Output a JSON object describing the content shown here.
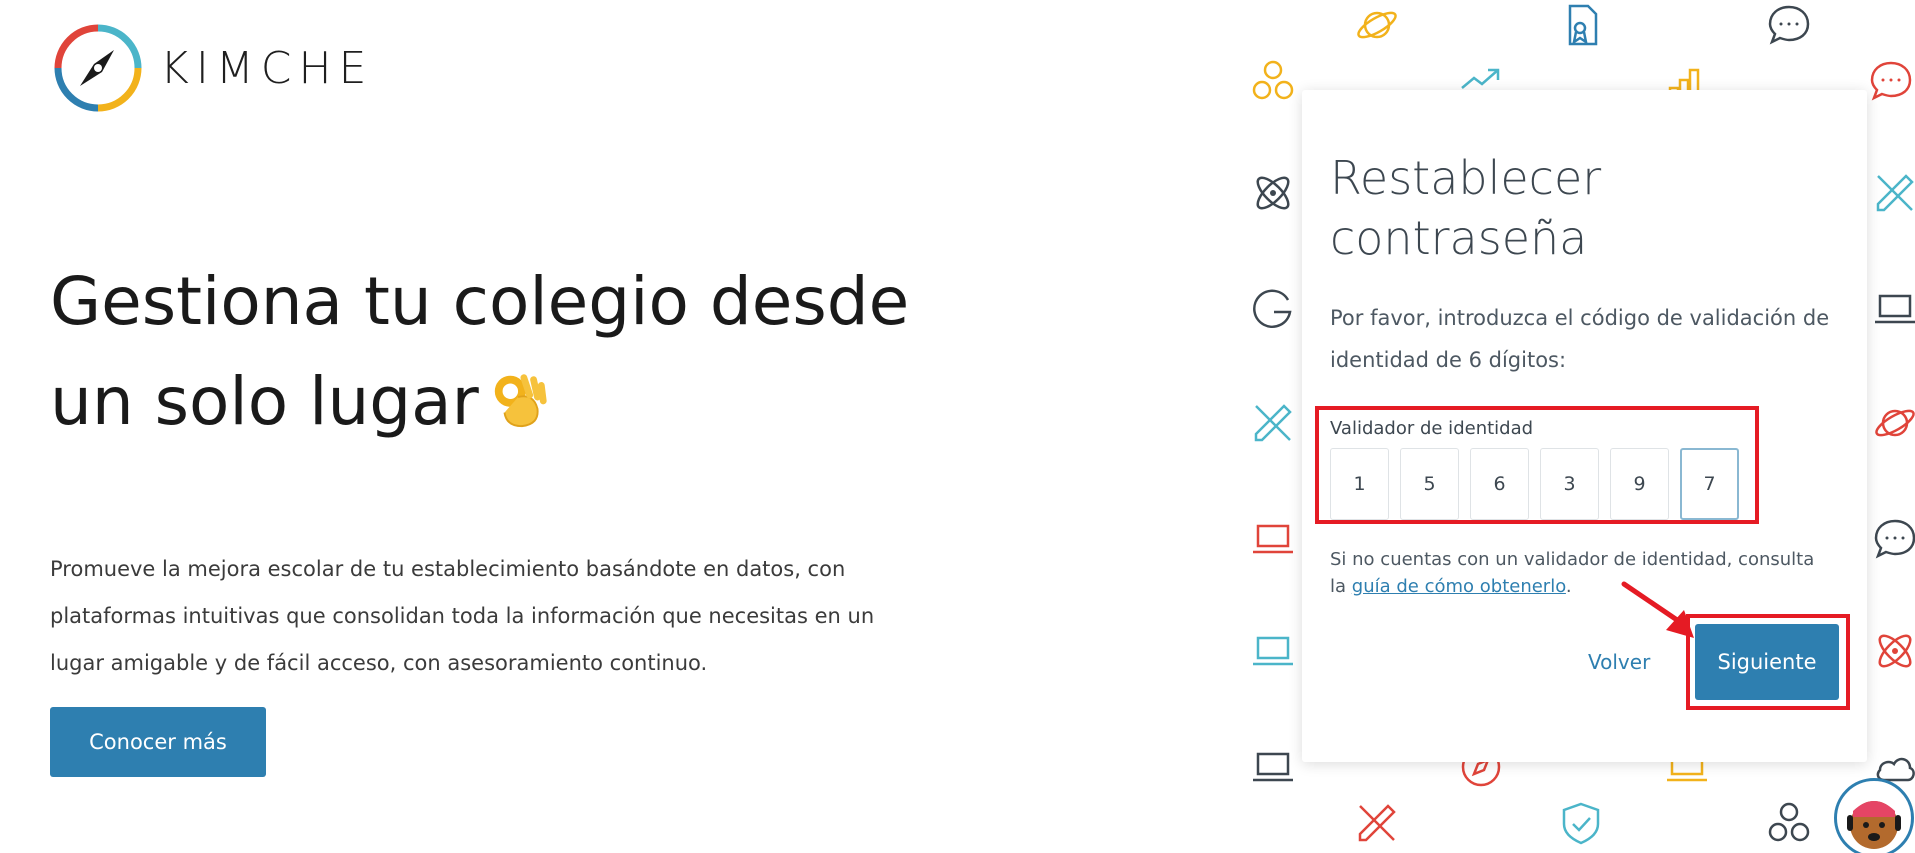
{
  "brand": {
    "name": "KIMCHE"
  },
  "hero": {
    "title": "Gestiona tu colegio desde un solo lugar",
    "description": "Promueve la mejora escolar de tu establecimiento basándote en datos, con plataformas intuitivas que consolidan toda la información que necesitas en un lugar amigable y de fácil acceso, con asesoramiento continuo.",
    "cta_label": "Conocer más"
  },
  "card": {
    "title": "Restablecer contraseña",
    "instruction": "Por favor, introduzca el código de validación de identidad de 6 dígitos:",
    "code_label": "Validador de identidad",
    "code_digits": [
      "1",
      "5",
      "6",
      "3",
      "9",
      "7"
    ],
    "help_prefix": "Si no cuentas con un validador de identidad, consulta la ",
    "help_link": "guía de cómo obtenerlo",
    "help_suffix": ".",
    "back_label": "Volver",
    "next_label": "Siguiente"
  },
  "colors": {
    "primary": "#2e7fb0",
    "highlight": "#e51b24",
    "icon_yellow": "#f2b21b",
    "icon_blue": "#4bb5c9",
    "icon_red": "#e0443a",
    "icon_dark": "#3d4750"
  },
  "icons": [
    "planet-icon",
    "certificate-icon",
    "chat-icon",
    "circles-icon",
    "trend-icon",
    "bar-chart-icon",
    "atom-icon",
    "pencil-ruler-icon",
    "g-letter-icon",
    "laptop-icon",
    "shield-check-icon",
    "compass-icon",
    "cloud-icon",
    "ok-hand-emoji",
    "red-arrow-icon",
    "dog-avatar"
  ]
}
